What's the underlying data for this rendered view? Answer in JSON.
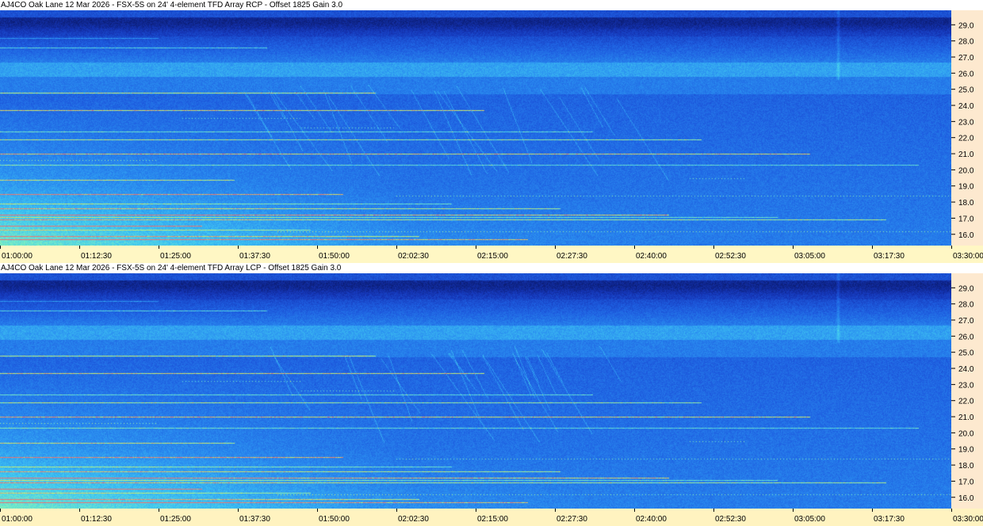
{
  "chart_data": [
    {
      "type": "heatmap",
      "title": "AJ4CO Oak Lane 12 Mar 2026 - FSX-5S on 24' 4-element TFD Array RCP  -  Offset 1825  Gain 3.0",
      "x_tick_labels": [
        "01:00:00",
        "01:12:30",
        "01:25:00",
        "01:37:30",
        "01:50:00",
        "02:02:30",
        "02:15:00",
        "02:27:30",
        "02:40:00",
        "02:52:30",
        "03:05:00",
        "03:17:30",
        "03:30:00"
      ],
      "y_tick_labels": [
        "29.0",
        "28.0",
        "27.0",
        "26.0",
        "25.0",
        "24.0",
        "23.0",
        "22.0",
        "21.0",
        "20.0",
        "19.0",
        "18.0",
        "17.0",
        "16.0"
      ],
      "y_values": [
        29.0,
        28.0,
        27.0,
        26.0,
        25.0,
        24.0,
        23.0,
        22.0,
        21.0,
        20.0,
        19.0,
        18.0,
        17.0,
        16.0
      ],
      "ylim": [
        15.3,
        29.9
      ],
      "xlim": [
        "01:00:00",
        "03:30:00"
      ],
      "colormap": [
        "#0a1a6e",
        "#1536b8",
        "#1e5ee0",
        "#2a8df0",
        "#3fc6f2",
        "#7ef0c0",
        "#d8f060",
        "#f07070"
      ]
    },
    {
      "type": "heatmap",
      "title": "AJ4CO Oak Lane 12 Mar 2026 - FSX-5S on 24' 4-element TFD Array LCP  -  Offset 1825  Gain 3.0",
      "x_tick_labels": [
        "01:00:00",
        "01:12:30",
        "01:25:00",
        "01:37:30",
        "01:50:00",
        "02:02:30",
        "02:15:00",
        "02:27:30",
        "02:40:00",
        "02:52:30",
        "03:05:00",
        "03:17:30",
        "03:30:00"
      ],
      "y_tick_labels": [
        "29.0",
        "28.0",
        "27.0",
        "26.0",
        "25.0",
        "24.0",
        "23.0",
        "22.0",
        "21.0",
        "20.0",
        "19.0",
        "18.0",
        "17.0",
        "16.0"
      ],
      "y_values": [
        29.0,
        28.0,
        27.0,
        26.0,
        25.0,
        24.0,
        23.0,
        22.0,
        21.0,
        20.0,
        19.0,
        18.0,
        17.0,
        16.0
      ],
      "ylim": [
        15.3,
        29.9
      ],
      "xlim": [
        "01:00:00",
        "03:30:00"
      ],
      "colormap": [
        "#0a1a6e",
        "#1536b8",
        "#1e5ee0",
        "#2a8df0",
        "#3fc6f2",
        "#7ef0c0",
        "#d8f060",
        "#f07070"
      ]
    }
  ]
}
